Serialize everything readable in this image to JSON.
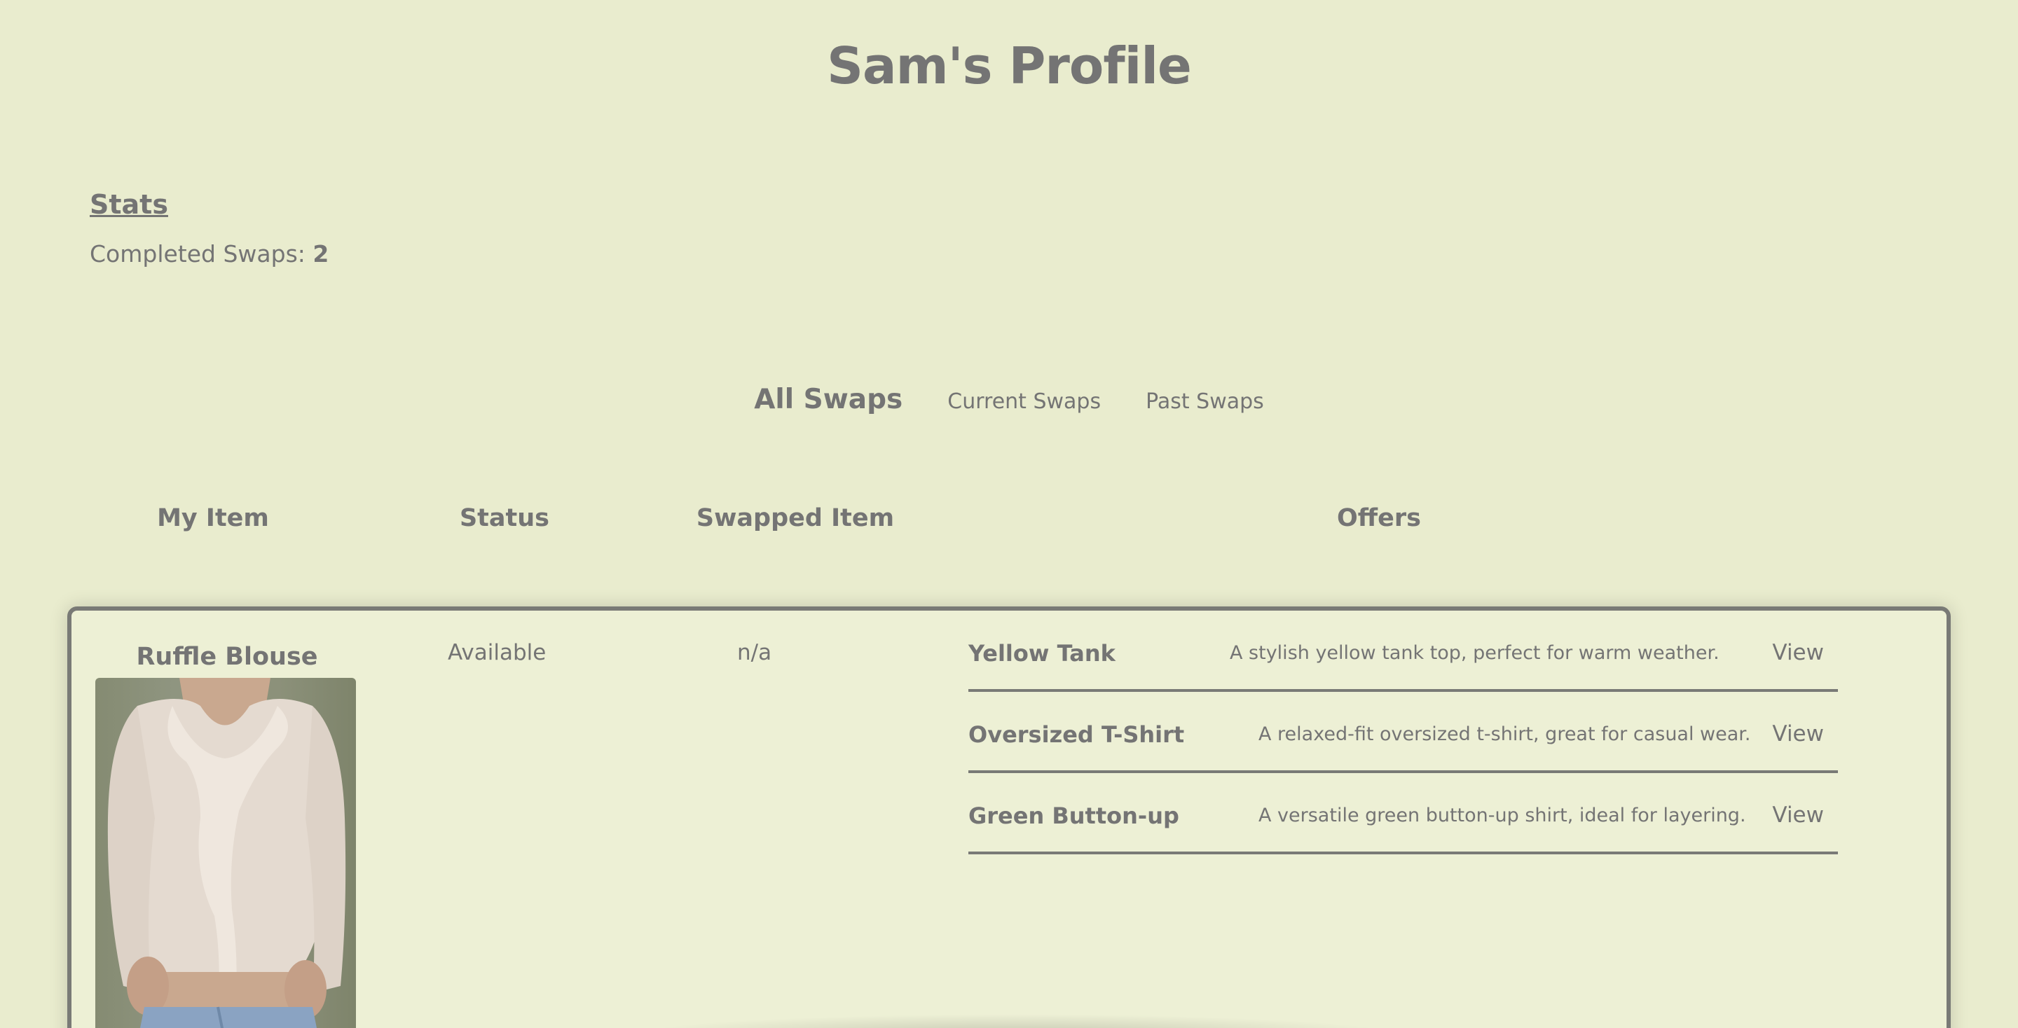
{
  "page": {
    "title": "Sam's Profile"
  },
  "stats": {
    "heading": "Stats",
    "completed_label": "Completed Swaps:",
    "completed_value": "2"
  },
  "tabs": [
    {
      "label": "All Swaps",
      "active": true
    },
    {
      "label": "Current Swaps",
      "active": false
    },
    {
      "label": "Past Swaps",
      "active": false
    }
  ],
  "columns": {
    "my_item": "My Item",
    "status": "Status",
    "swapped_item": "Swapped Item",
    "offers": "Offers"
  },
  "swap": {
    "item_name": "Ruffle Blouse",
    "status": "Available",
    "swapped_item": "n/a",
    "offers": [
      {
        "name": "Yellow Tank",
        "description": "A stylish yellow tank top, perfect for warm weather.",
        "action": "View"
      },
      {
        "name": "Oversized T-Shirt",
        "description": "A relaxed-fit oversized t-shirt, great for casual wear.",
        "action": "View"
      },
      {
        "name": "Green Button-up",
        "description": "A versatile green button-up shirt, ideal for layering.",
        "action": "View"
      }
    ]
  },
  "colors": {
    "background": "#e9ecce",
    "card": "#edf0d5",
    "text": "#747474",
    "border": "#797a76"
  }
}
